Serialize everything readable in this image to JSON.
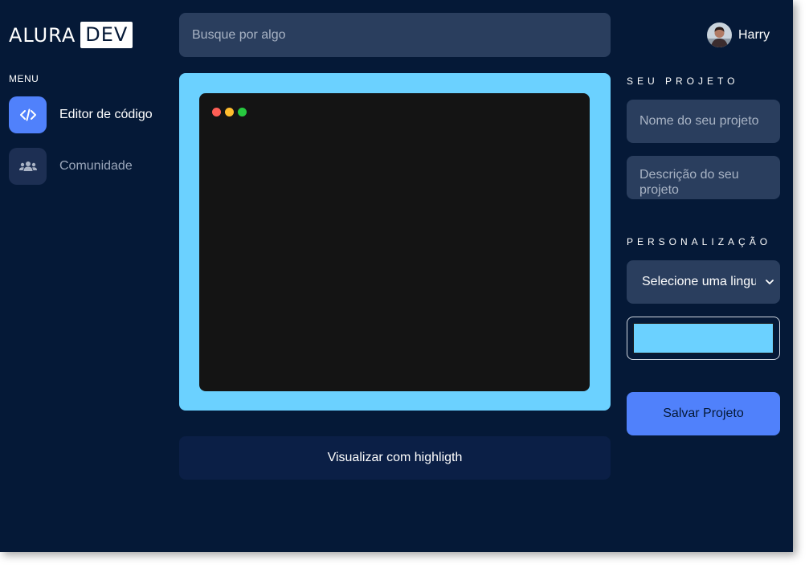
{
  "logo": {
    "primary": "ALURA",
    "secondary": "DEV"
  },
  "sidebar": {
    "menu_title": "MENU",
    "items": [
      {
        "label": "Editor de código",
        "icon": "code-icon",
        "active": true
      },
      {
        "label": "Comunidade",
        "icon": "users-icon",
        "active": false
      }
    ]
  },
  "search": {
    "placeholder": "Busque por algo"
  },
  "user": {
    "name": "Harry"
  },
  "editor": {
    "highlight_label": "Visualizar com highligth"
  },
  "project": {
    "section_title": "SEU PROJETO",
    "name_placeholder": "Nome do seu projeto",
    "description_placeholder": "Descrição do seu projeto"
  },
  "customization": {
    "section_title": "PERSONALIZAÇÃO",
    "language_select": "Selecione uma linguagem",
    "color": "#6bd1ff"
  },
  "save_label": "Salvar Projeto",
  "colors": {
    "background": "#051937",
    "accent": "#5081fb",
    "editor_border": "#6bd1ff",
    "input_bg": "#2a3e5e"
  }
}
